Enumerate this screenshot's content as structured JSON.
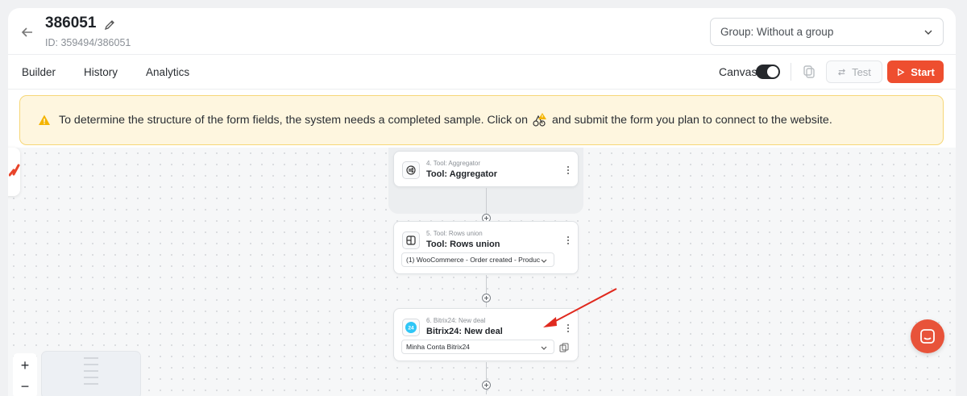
{
  "header": {
    "title": "386051",
    "id_text": "ID: 359494/386051",
    "group_select_value": "Group: Without a group"
  },
  "tabs": [
    {
      "label": "Builder"
    },
    {
      "label": "History"
    },
    {
      "label": "Analytics"
    }
  ],
  "toolbar": {
    "canvas_label": "Canvas",
    "canvas_toggle": "on",
    "test_label": "Test",
    "start_label": "Start",
    "accent_color": "#ee4e2f"
  },
  "banner": {
    "text_before": "To determine the structure of the form fields, the system needs a completed sample. Click on",
    "text_after": "and submit the form you plan to connect to the website."
  },
  "nodes": [
    {
      "subtitle": "4. Tool: Aggregator",
      "title": "Tool: Aggregator",
      "icon": "aggregator-icon"
    },
    {
      "subtitle": "5. Tool: Rows union",
      "title": "Tool: Rows union",
      "icon": "rows-union-icon",
      "select_value": "(1) WooCommerce - Order created - Produc"
    },
    {
      "subtitle": "6. Bitrix24: New deal",
      "title": "Bitrix24: New deal",
      "icon": "bitrix24-icon",
      "select_value": "Minha Conta Bitrix24"
    }
  ],
  "zoom": {
    "in_label": "+",
    "out_label": "−"
  }
}
